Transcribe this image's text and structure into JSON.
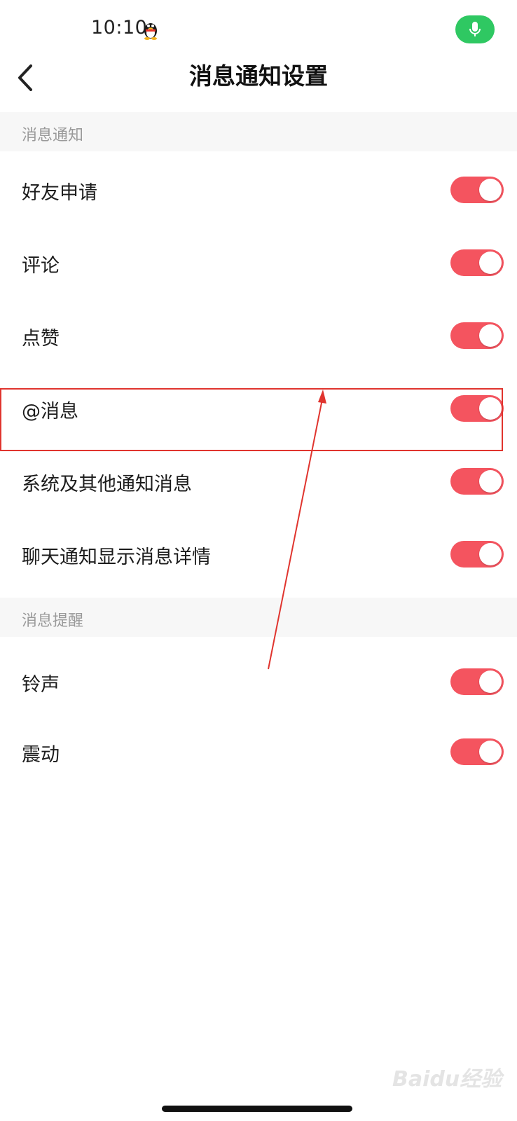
{
  "status_bar": {
    "time": "10:10",
    "app_icon": "qq-penguin-icon",
    "mic_icon": "microphone-icon",
    "mic_color": "#2fc862"
  },
  "nav": {
    "back_icon": "chevron-left-icon",
    "title": "消息通知设置"
  },
  "sections": [
    {
      "header": "消息通知",
      "items": [
        {
          "label": "好友申请",
          "enabled": true
        },
        {
          "label": "评论",
          "enabled": true
        },
        {
          "label": "点赞",
          "enabled": true
        },
        {
          "label": "@消息",
          "enabled": true
        },
        {
          "label": "系统及其他通知消息",
          "enabled": true
        },
        {
          "label": "聊天通知显示消息详情",
          "enabled": true
        }
      ]
    },
    {
      "header": "消息提醒",
      "items": [
        {
          "label": "铃声",
          "enabled": true
        },
        {
          "label": "震动",
          "enabled": true
        }
      ]
    }
  ],
  "toggle_color": "#f4545f",
  "annotation_color": "#e0342e",
  "watermark": "Baidu经验"
}
